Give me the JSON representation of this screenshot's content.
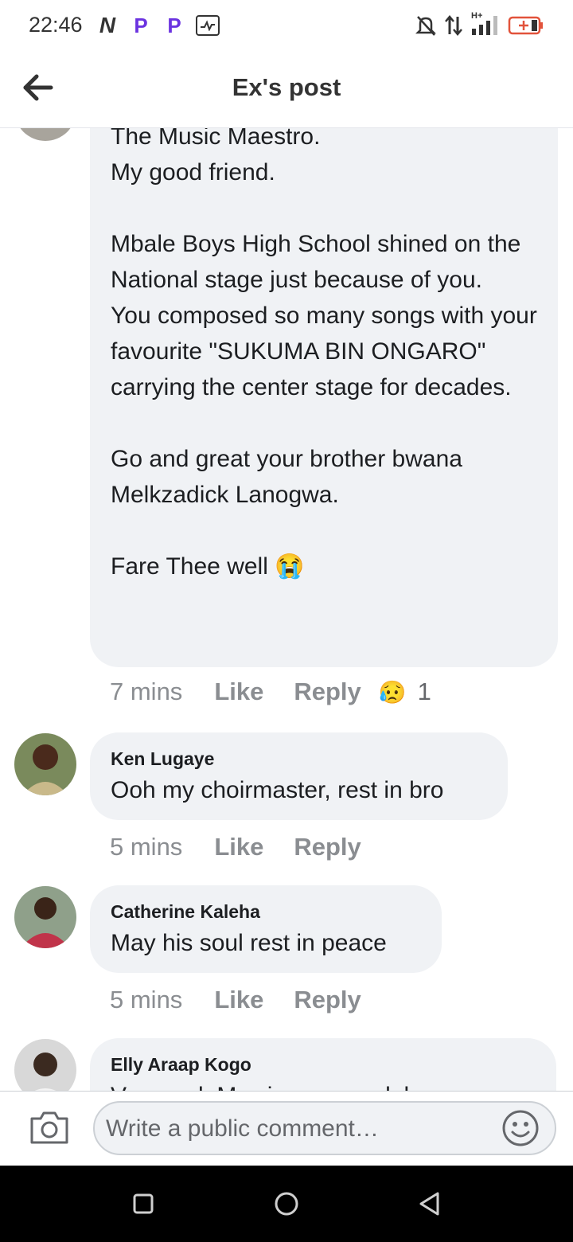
{
  "status_bar": {
    "time": "22:46",
    "left_icons": [
      "N",
      "P",
      "P",
      "activity"
    ],
    "right_icons": [
      "mute-icon",
      "data-transfer-icon",
      "signal-icon",
      "battery-icon"
    ],
    "signal_label": "H+"
  },
  "header": {
    "title": "Ex's post"
  },
  "comments": [
    {
      "text": "The Music Maestro.\nMy good friend.\n\nMbale Boys High School shined on the National stage just because of you.\nYou composed so many songs with your favourite \"SUKUMA BIN ONGARO\" carrying the center stage for decades.\n\nGo and great your brother bwana Melkzadick Lanogwa.\n\nFare Thee well",
      "emoji": "😭",
      "time": "7 mins",
      "like": "Like",
      "reply": "Reply",
      "reaction_emoji": "😥",
      "reaction_count": "1"
    },
    {
      "author": "Ken Lugaye",
      "text": "Ooh my choirmaster, rest in bro",
      "time": "5 mins",
      "like": "Like",
      "reply": "Reply"
    },
    {
      "author": "Catherine Kaleha",
      "text": "May his soul rest in peace",
      "time": "5 mins",
      "like": "Like",
      "reply": "Reply"
    },
    {
      "author": "Elly Araap Kogo",
      "text": "Very sad. My sincere condolences"
    }
  ],
  "composer": {
    "placeholder": "Write a public comment…"
  },
  "colors": {
    "bubble": "#f0f2f5",
    "muted_text": "#8a8d91",
    "brand_p": "#6b33e0",
    "battery": "#e2533b"
  }
}
